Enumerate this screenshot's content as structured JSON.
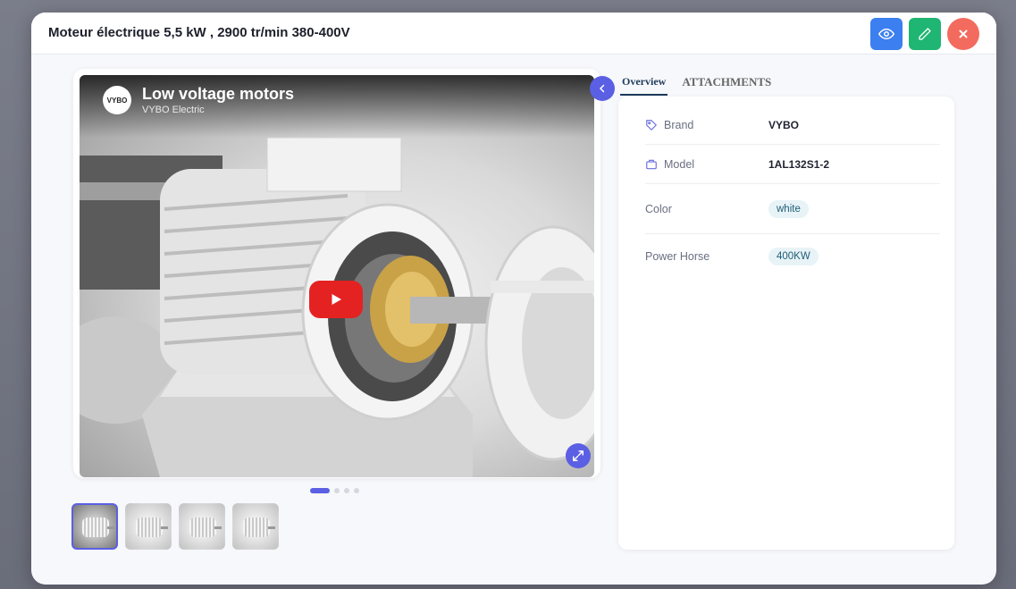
{
  "modal": {
    "title": "Moteur électrique 5,5 kW , 2900 tr/min 380-400V",
    "actions": [
      "view-icon",
      "edit-icon",
      "close-icon"
    ]
  },
  "video": {
    "title": "Low voltage motors",
    "channel": "VYBO Electric",
    "channel_logo_text": "VYBO",
    "carousel_position": {
      "current": 1,
      "total": 4
    }
  },
  "thumbnails": [
    {
      "label": "video",
      "active": true
    },
    {
      "label": "image-2",
      "active": false
    },
    {
      "label": "image-3",
      "active": false
    },
    {
      "label": "image-4",
      "active": false
    }
  ],
  "tabs": [
    {
      "label": "Overview",
      "active": true
    },
    {
      "label": "ATTACHMENTS",
      "active": false
    }
  ],
  "details": [
    {
      "label": "Brand",
      "icon": "tag-icon",
      "value": "VYBO"
    },
    {
      "label": "Model",
      "icon": "briefcase-icon",
      "value": "1AL132S1-2"
    },
    {
      "label": "Color",
      "icon": "",
      "value": "white"
    },
    {
      "label": "Power Horse",
      "icon": "",
      "value": "400KW"
    }
  ],
  "colors": {
    "primary": "#5b5fe3",
    "view_button": "#3c7ff0",
    "edit_button": "#1fb572",
    "close_button": "#f26b5e",
    "play_button": "#e52222"
  }
}
